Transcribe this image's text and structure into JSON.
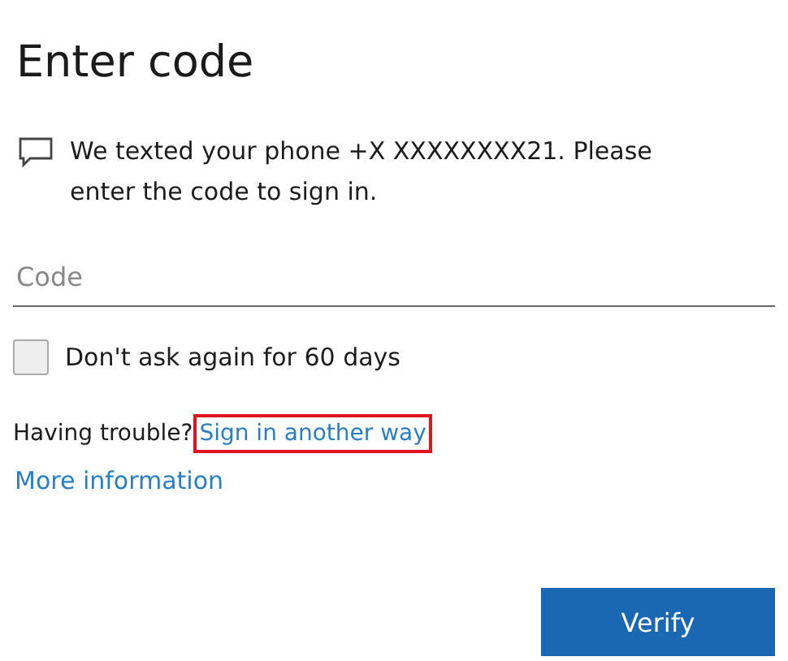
{
  "title": "Enter code",
  "message": "We texted your phone +X XXXXXXXX21. Please enter the code to sign in.",
  "code_field": {
    "placeholder": "Code"
  },
  "remember": {
    "label": "Don't ask again for 60 days",
    "checked": false
  },
  "trouble": {
    "text": "Having trouble?",
    "link": "Sign in another way",
    "highlighted": true
  },
  "more_link": "More information",
  "buttons": [
    "Verify"
  ]
}
